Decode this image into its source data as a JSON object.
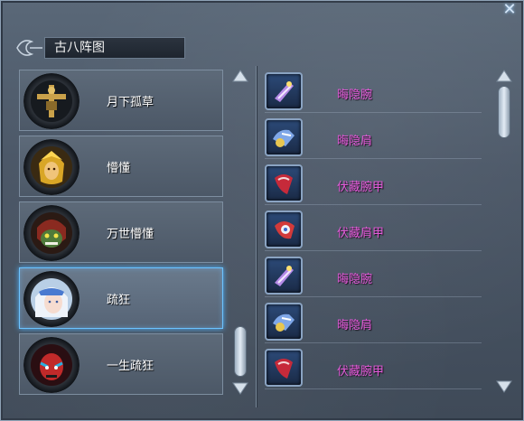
{
  "window": {
    "title": "古八阵图"
  },
  "roles": [
    {
      "name": "月下孤草",
      "avatar": "golden-cross-icon",
      "selected": false
    },
    {
      "name": "懵懂",
      "avatar": "golden-warrior-icon",
      "selected": false
    },
    {
      "name": "万世懵懂",
      "avatar": "green-monster-icon",
      "selected": false
    },
    {
      "name": "疏狂",
      "avatar": "white-hair-girl-icon",
      "selected": true
    },
    {
      "name": "一生疏狂",
      "avatar": "red-demon-icon",
      "selected": false
    }
  ],
  "items": [
    {
      "name": "晦隐腕",
      "icon": "purple-gauntlet-icon"
    },
    {
      "name": "晦隐肩",
      "icon": "blue-shoulder-icon"
    },
    {
      "name": "伏藏腕甲",
      "icon": "red-gauntlet-icon"
    },
    {
      "name": "伏藏肩甲",
      "icon": "red-shoulder-icon"
    },
    {
      "name": "晦隐腕",
      "icon": "purple-gauntlet-icon"
    },
    {
      "name": "晦隐肩",
      "icon": "blue-shoulder-icon"
    },
    {
      "name": "伏藏腕甲",
      "icon": "red-gauntlet-icon"
    }
  ],
  "colors": {
    "item_text": "#e35ad9",
    "selection_glow": "#4fb4ff"
  }
}
